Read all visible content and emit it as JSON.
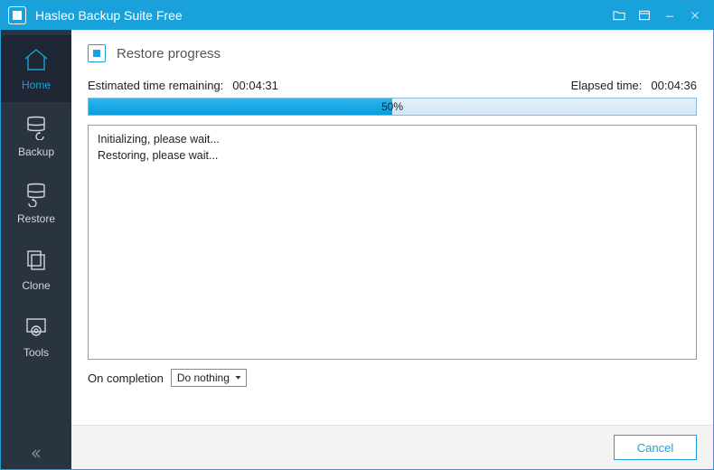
{
  "titlebar": {
    "app_title": "Hasleo Backup Suite Free"
  },
  "sidebar": {
    "items": [
      {
        "label": "Home"
      },
      {
        "label": "Backup"
      },
      {
        "label": "Restore"
      },
      {
        "label": "Clone"
      },
      {
        "label": "Tools"
      }
    ]
  },
  "page": {
    "title": "Restore progress",
    "eta_label": "Estimated time remaining:",
    "eta_value": "00:04:31",
    "elapsed_label": "Elapsed time:",
    "elapsed_value": "00:04:36",
    "progress_percent": 50,
    "progress_text": "50%",
    "log_lines": [
      "Initializing, please wait...",
      "Restoring, please wait..."
    ],
    "completion_label": "On completion",
    "completion_selected": "Do nothing"
  },
  "footer": {
    "cancel_label": "Cancel"
  }
}
